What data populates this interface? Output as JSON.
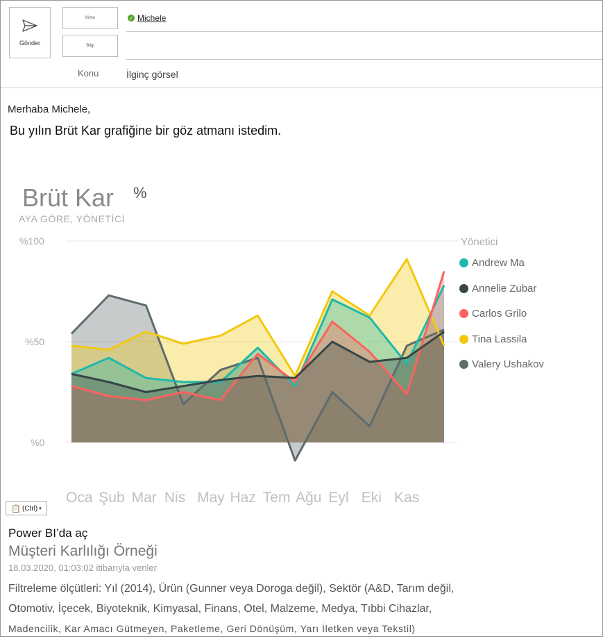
{
  "compose": {
    "send_label": "Gönder",
    "to_label": "Kime",
    "cc_label": "Bilgi",
    "recipient": "Michele",
    "subject_label": "Konu",
    "subject_value": "İlginç görsel"
  },
  "body": {
    "greeting": "Merhaba Michele,",
    "message": "Bu yılın Brüt Kar grafiğine bir göz atmanı istedim."
  },
  "chart_data": {
    "type": "area",
    "title": "Brüt Kar",
    "title_suffix": "%",
    "subtitle": "AYA GÖRE, YÖNETİCİ",
    "y_ticks": [
      "%100",
      "%50",
      "%0"
    ],
    "ylim": [
      0,
      100
    ],
    "categories": [
      "Oca",
      "Şub",
      "Mar",
      "Nis",
      "May",
      "Haz",
      "Tem",
      "Ağu",
      "Eyl",
      "Eki",
      "Kas"
    ],
    "legend_title": "Yönetici",
    "legend_position": "right",
    "grid": true,
    "series": [
      {
        "name": "Andrew Ma",
        "color": "#1fb8aa",
        "values": [
          34,
          42,
          32,
          30,
          30,
          47,
          28,
          71,
          62,
          39,
          78
        ]
      },
      {
        "name": "Annelie Zubar",
        "color": "#374649",
        "values": [
          34,
          30,
          25,
          28,
          31,
          33,
          32,
          50,
          40,
          42,
          55
        ]
      },
      {
        "name": "Carlos Grilo",
        "color": "#fd625e",
        "values": [
          28,
          23,
          21,
          25,
          21,
          44,
          30,
          60,
          45,
          24,
          85
        ]
      },
      {
        "name": "Tina Lassila",
        "color": "#f2c80f",
        "values": [
          48,
          46,
          55,
          49,
          53,
          63,
          33,
          75,
          63,
          91,
          48
        ]
      },
      {
        "name": "Valery Ushakov",
        "color": "#5f6b6d",
        "values": [
          54,
          73,
          68,
          19,
          36,
          42,
          -9,
          25,
          8,
          48,
          56
        ]
      }
    ]
  },
  "footer": {
    "ctrl_label": "(Ctrl)",
    "open_link": "Power BI’da aç",
    "report_name": "Müşteri Karlılığı Örneği",
    "timestamp": "18.03.2020, 01:03:02 itibarıyla veriler",
    "filters_line1": "Filtreleme ölçütleri: Yıl (2014), Ürün (Gunner veya Doroga değil), Sektör (A&D, Tarım değil,",
    "filters_line2": "Otomotiv, İçecek, Biyoteknik, Kimyasal, Finans, Otel, Malzeme, Medya, Tıbbi Cihazlar,",
    "filters_line3": "Madencilik, Kar Amacı Gütmeyen, Paketleme, Geri Dönüşüm, Yarı İletken veya Tekstil)"
  }
}
